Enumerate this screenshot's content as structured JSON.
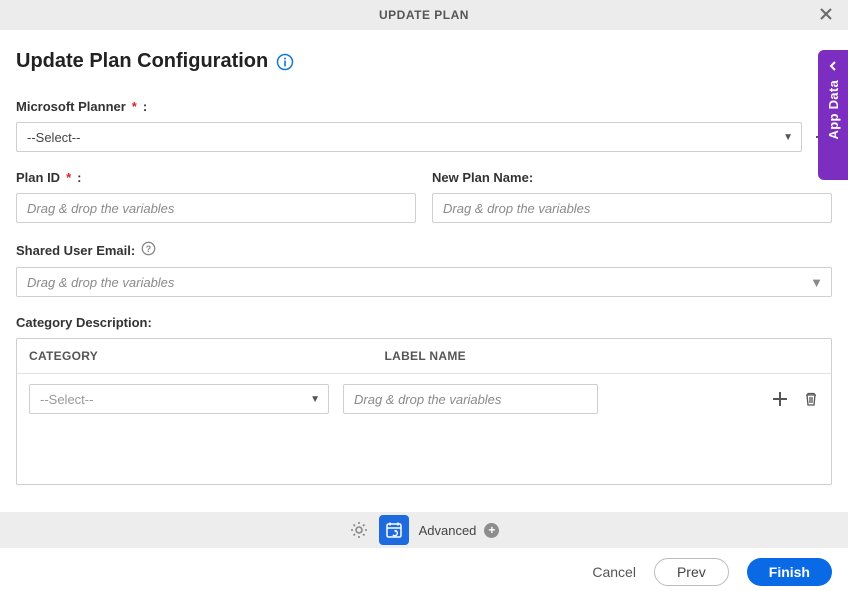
{
  "header": {
    "title": "UPDATE PLAN"
  },
  "page_title": "Update Plan Configuration",
  "fields": {
    "planner": {
      "label": "Microsoft Planner",
      "selected": "--Select--"
    },
    "plan_id": {
      "label": "Plan ID",
      "placeholder": "Drag & drop the variables"
    },
    "new_plan_name": {
      "label": "New Plan Name:",
      "placeholder": "Drag & drop the variables"
    },
    "shared_user_email": {
      "label": "Shared User Email:",
      "placeholder": "Drag & drop the variables"
    },
    "category_description": {
      "label": "Category Description:"
    }
  },
  "category_table": {
    "columns": [
      "CATEGORY",
      "LABEL NAME"
    ],
    "row": {
      "category_selected": "--Select--",
      "label_placeholder": "Drag & drop the variables"
    }
  },
  "footer": {
    "advanced_label": "Advanced"
  },
  "actions": {
    "cancel": "Cancel",
    "prev": "Prev",
    "finish": "Finish"
  },
  "side_tab": {
    "label": "App Data"
  }
}
